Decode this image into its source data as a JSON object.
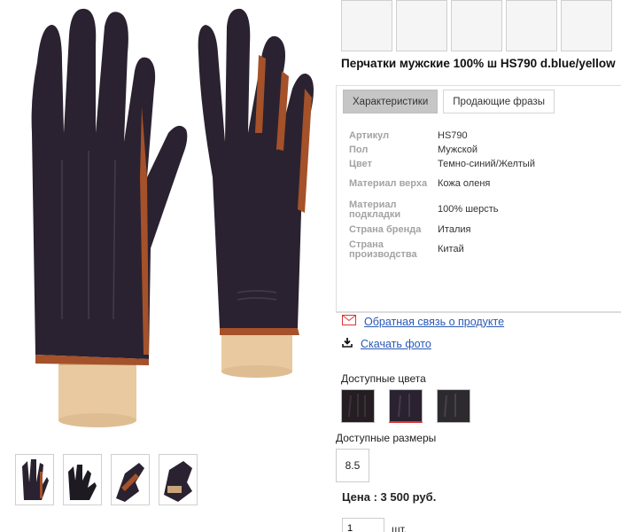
{
  "product": {
    "title": "Перчатки мужские 100% ш HS790 d.blue/yellow"
  },
  "tabs": [
    {
      "label": "Характеристики",
      "active": true
    },
    {
      "label": "Продающие фразы",
      "active": false
    }
  ],
  "specs": [
    {
      "label": "Артикул",
      "value": "HS790"
    },
    {
      "label": "Пол",
      "value": "Мужской"
    },
    {
      "label": "Цвет",
      "value": "Темно-синий/Желтый"
    },
    {
      "label": "Материал верха",
      "value": "Кожа оленя"
    },
    {
      "label": "Материал подкладки",
      "value": "100% шерсть"
    },
    {
      "label": "Страна бренда",
      "value": "Италия"
    },
    {
      "label": "Страна производства",
      "value": "Китай"
    }
  ],
  "links": {
    "feedback": "Обратная связь о продукте",
    "download_photo": "Скачать фото"
  },
  "colors_label": "Доступные цвета",
  "sizes_label": "Доступные размеры",
  "sizes": [
    "8.5"
  ],
  "price": "Цена : 3 500 руб.",
  "quantity": {
    "value": "1",
    "unit": "шт."
  },
  "icons": {
    "feedback": "envelope-icon",
    "download": "download-icon"
  },
  "palette": {
    "glove_dark": "#2a2230",
    "glove_accent": "#a5512a",
    "stand_wood": "#e8c9a0",
    "link": "#2a59b6",
    "selected_underline": "#dd3333"
  }
}
